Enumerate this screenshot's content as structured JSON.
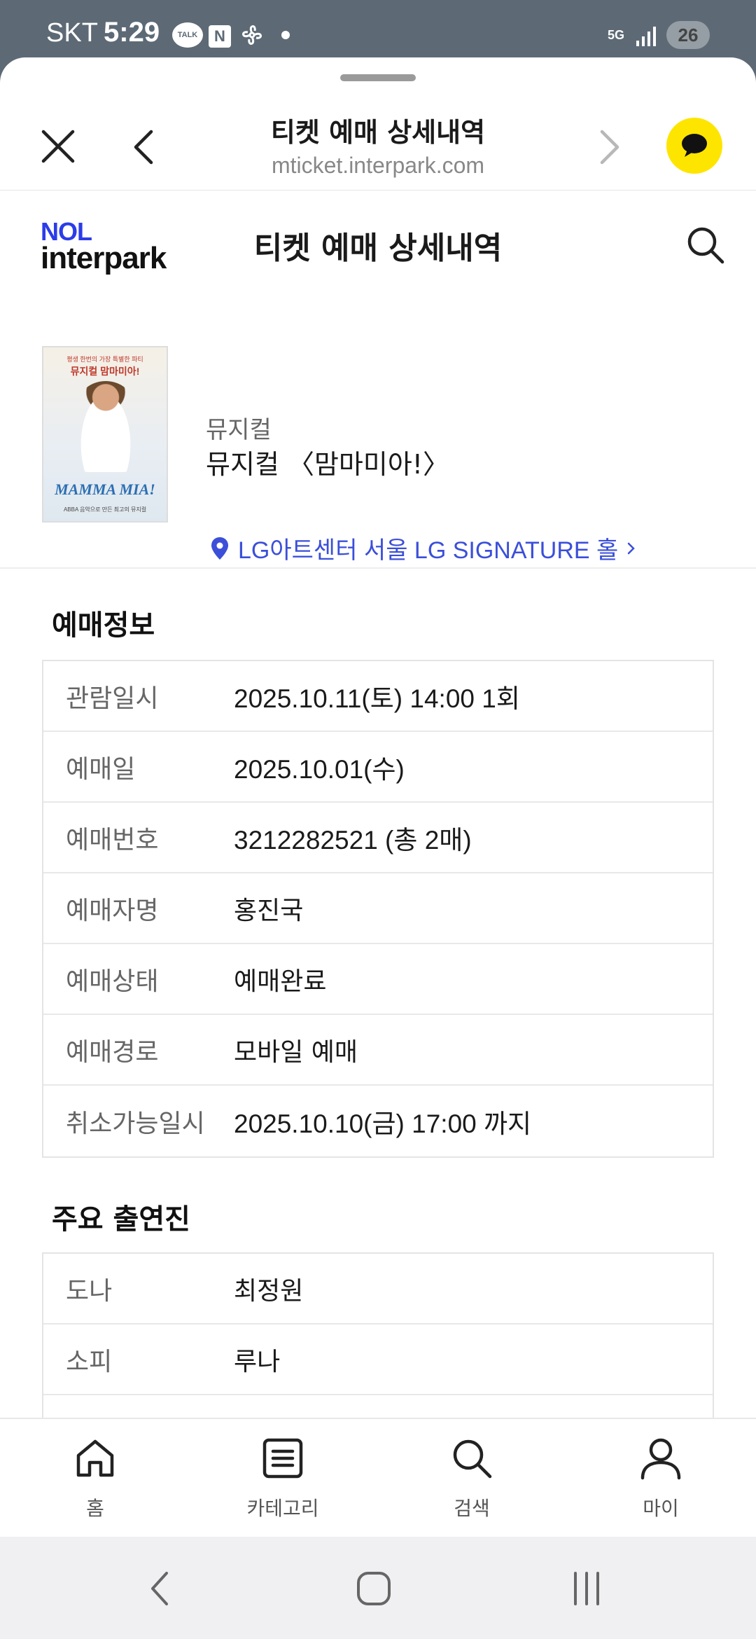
{
  "status_bar": {
    "carrier": "SKT",
    "time": "5:29",
    "icons": [
      "kakaotalk-icon",
      "naver-icon",
      "fan-icon",
      "dot-icon",
      "5g-icon",
      "signal-icon",
      "battery-icon"
    ],
    "talk_label": "TALK",
    "naver_label": "N",
    "network_label": "5G",
    "battery_level": "26"
  },
  "browser": {
    "title": "티켓 예매 상세내역",
    "url": "mticket.interpark.com"
  },
  "header": {
    "logo_top": "NOL",
    "logo_bottom": "interpark",
    "page_title": "티켓 예매 상세내역"
  },
  "product": {
    "genre": "뮤지컬",
    "name": "뮤지컬 〈맘마미아!〉",
    "venue": "LG아트센터 서울 LG SIGNATURE 홀",
    "poster": {
      "top_text": "평생 한번의 가장 특별한 파티",
      "sub_text": "뮤지컬 맘마미아!",
      "brand": "MAMMA MIA!",
      "foot_text": "ABBA 음악으로 만든 최고의 뮤지컬"
    }
  },
  "booking_info": {
    "title": "예매정보",
    "rows": [
      {
        "label": "관람일시",
        "value": "2025.10.11(토) 14:00 1회"
      },
      {
        "label": "예매일",
        "value": "2025.10.01(수)"
      },
      {
        "label": "예매번호",
        "value": "3212282521 (총 2매)"
      },
      {
        "label": "예매자명",
        "value": "홍진국"
      },
      {
        "label": "예매상태",
        "value": "예매완료"
      },
      {
        "label": "예매경로",
        "value": "모바일 예매"
      },
      {
        "label": "취소가능일시",
        "value": "2025.10.10(금) 17:00 까지"
      }
    ]
  },
  "cast": {
    "title": "주요 출연진",
    "rows": [
      {
        "label": "도나",
        "value": "최정원"
      },
      {
        "label": "소피",
        "value": "루나"
      }
    ]
  },
  "bottom_nav": {
    "items": [
      {
        "label": "홈",
        "icon": "home-icon"
      },
      {
        "label": "카테고리",
        "icon": "category-icon"
      },
      {
        "label": "검색",
        "icon": "search-icon"
      },
      {
        "label": "마이",
        "icon": "user-icon"
      }
    ]
  },
  "colors": {
    "status_bar_bg": "#5d6a76",
    "brand_blue": "#2b3de8",
    "venue_link": "#3b4fd9",
    "kakao_yellow": "#fee500"
  }
}
